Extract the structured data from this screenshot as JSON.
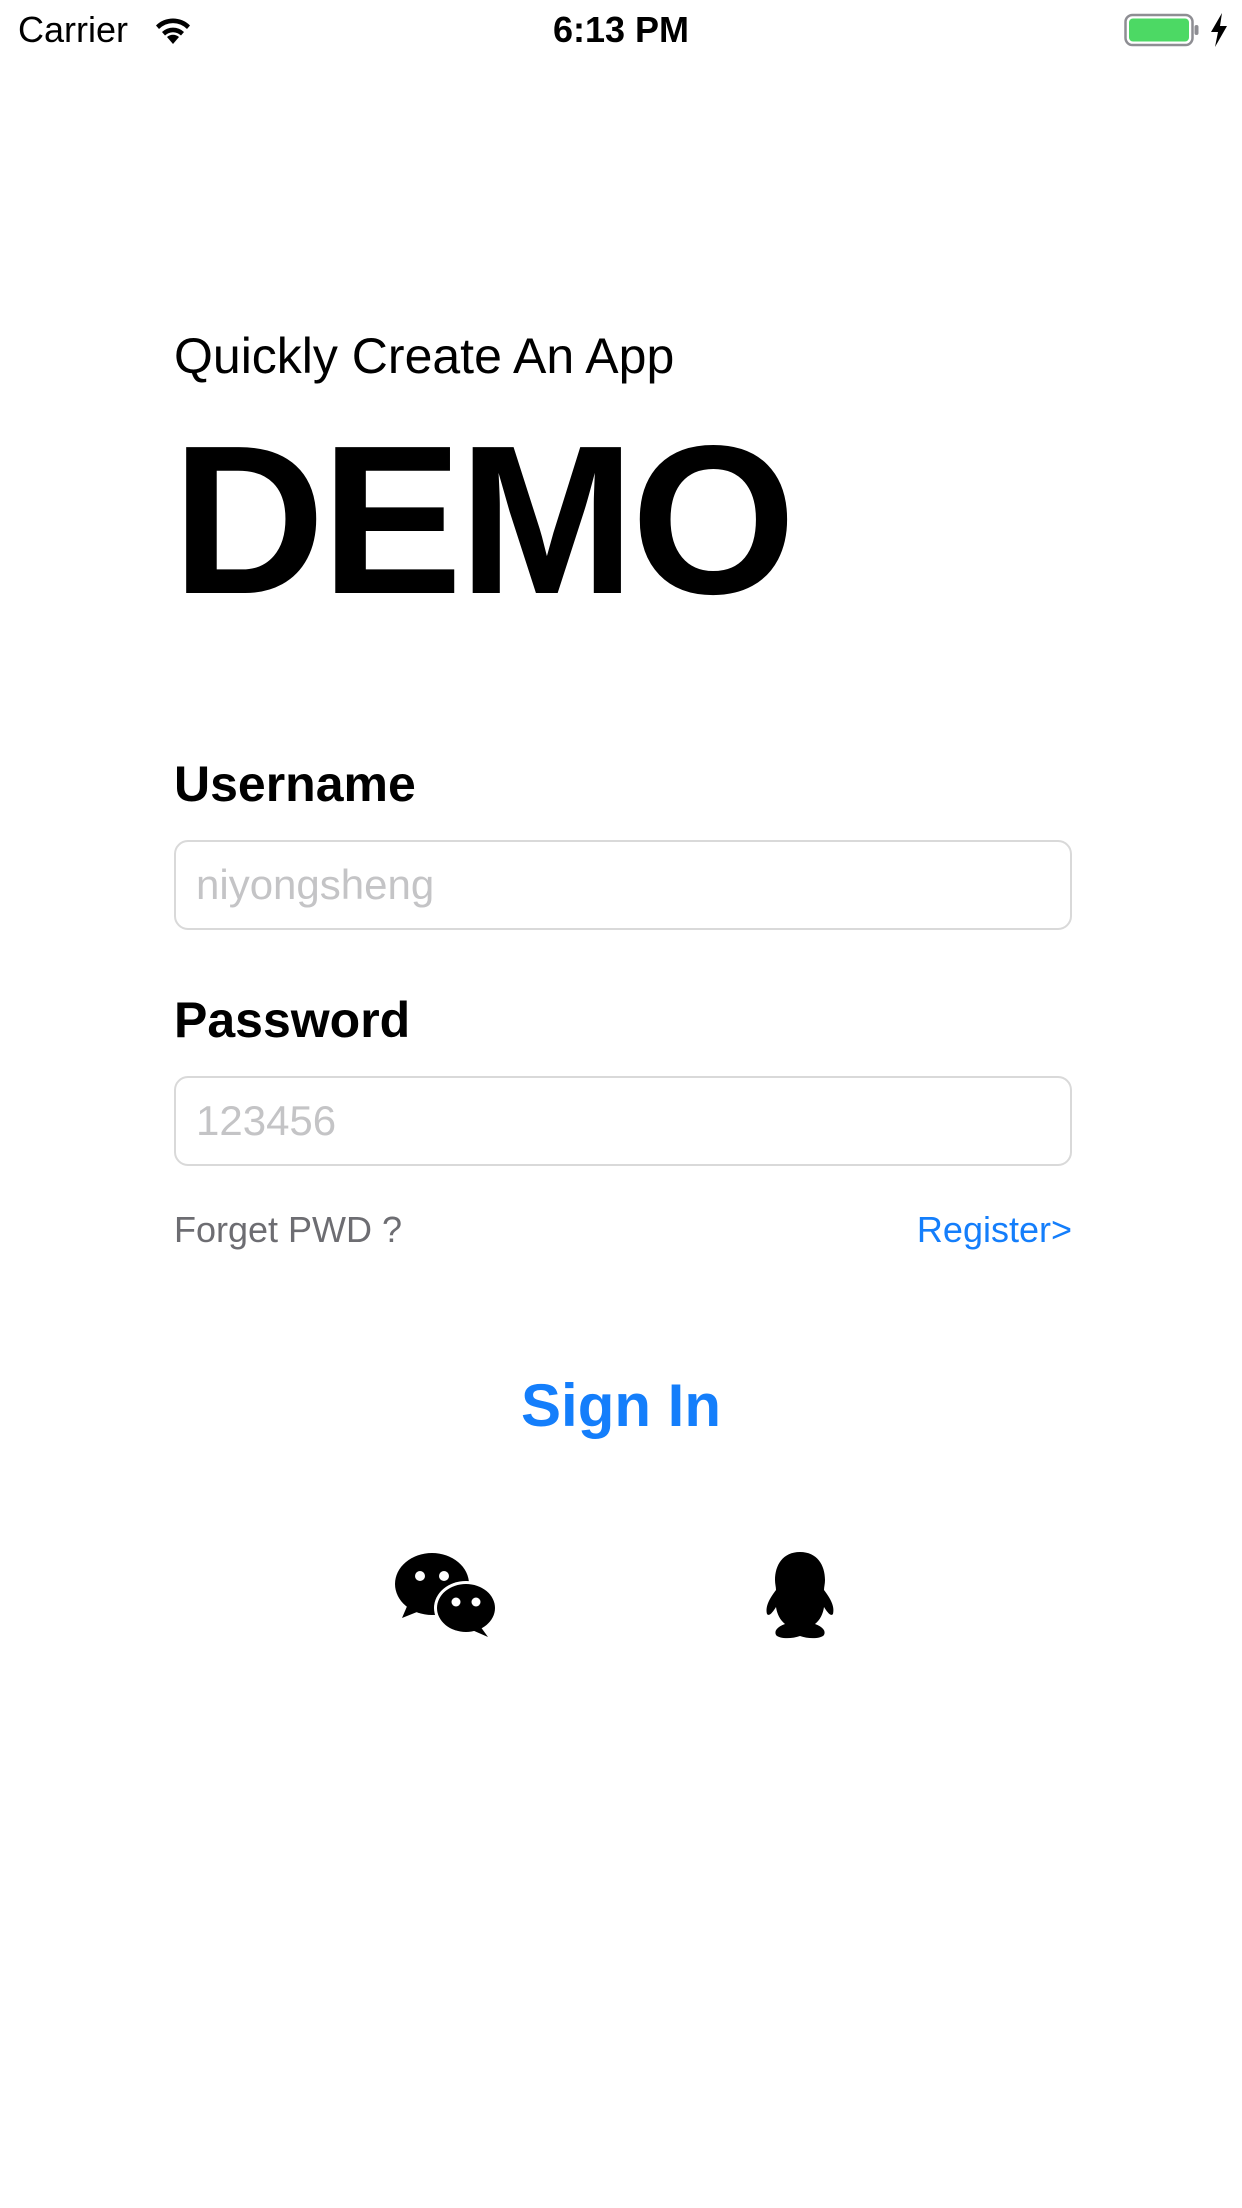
{
  "status_bar": {
    "carrier": "Carrier",
    "time": "6:13 PM",
    "battery_color": "#4cd964",
    "icons": [
      "wifi-icon",
      "battery-icon",
      "charging-icon"
    ]
  },
  "header": {
    "subtitle": "Quickly Create An App",
    "title": "DEMO"
  },
  "form": {
    "username": {
      "label": "Username",
      "placeholder": "niyongsheng",
      "value": ""
    },
    "password": {
      "label": "Password",
      "placeholder": "123456",
      "value": ""
    },
    "forget_link": "Forget PWD ?",
    "register_link": "Register>",
    "sign_in_label": "Sign In"
  },
  "social_login": {
    "icons": [
      "wechat-icon",
      "qq-icon"
    ]
  },
  "colors": {
    "accent": "#147efb",
    "secondary_text": "#6d6d72",
    "placeholder": "#c4c4c6",
    "border": "#d9d9d9"
  }
}
